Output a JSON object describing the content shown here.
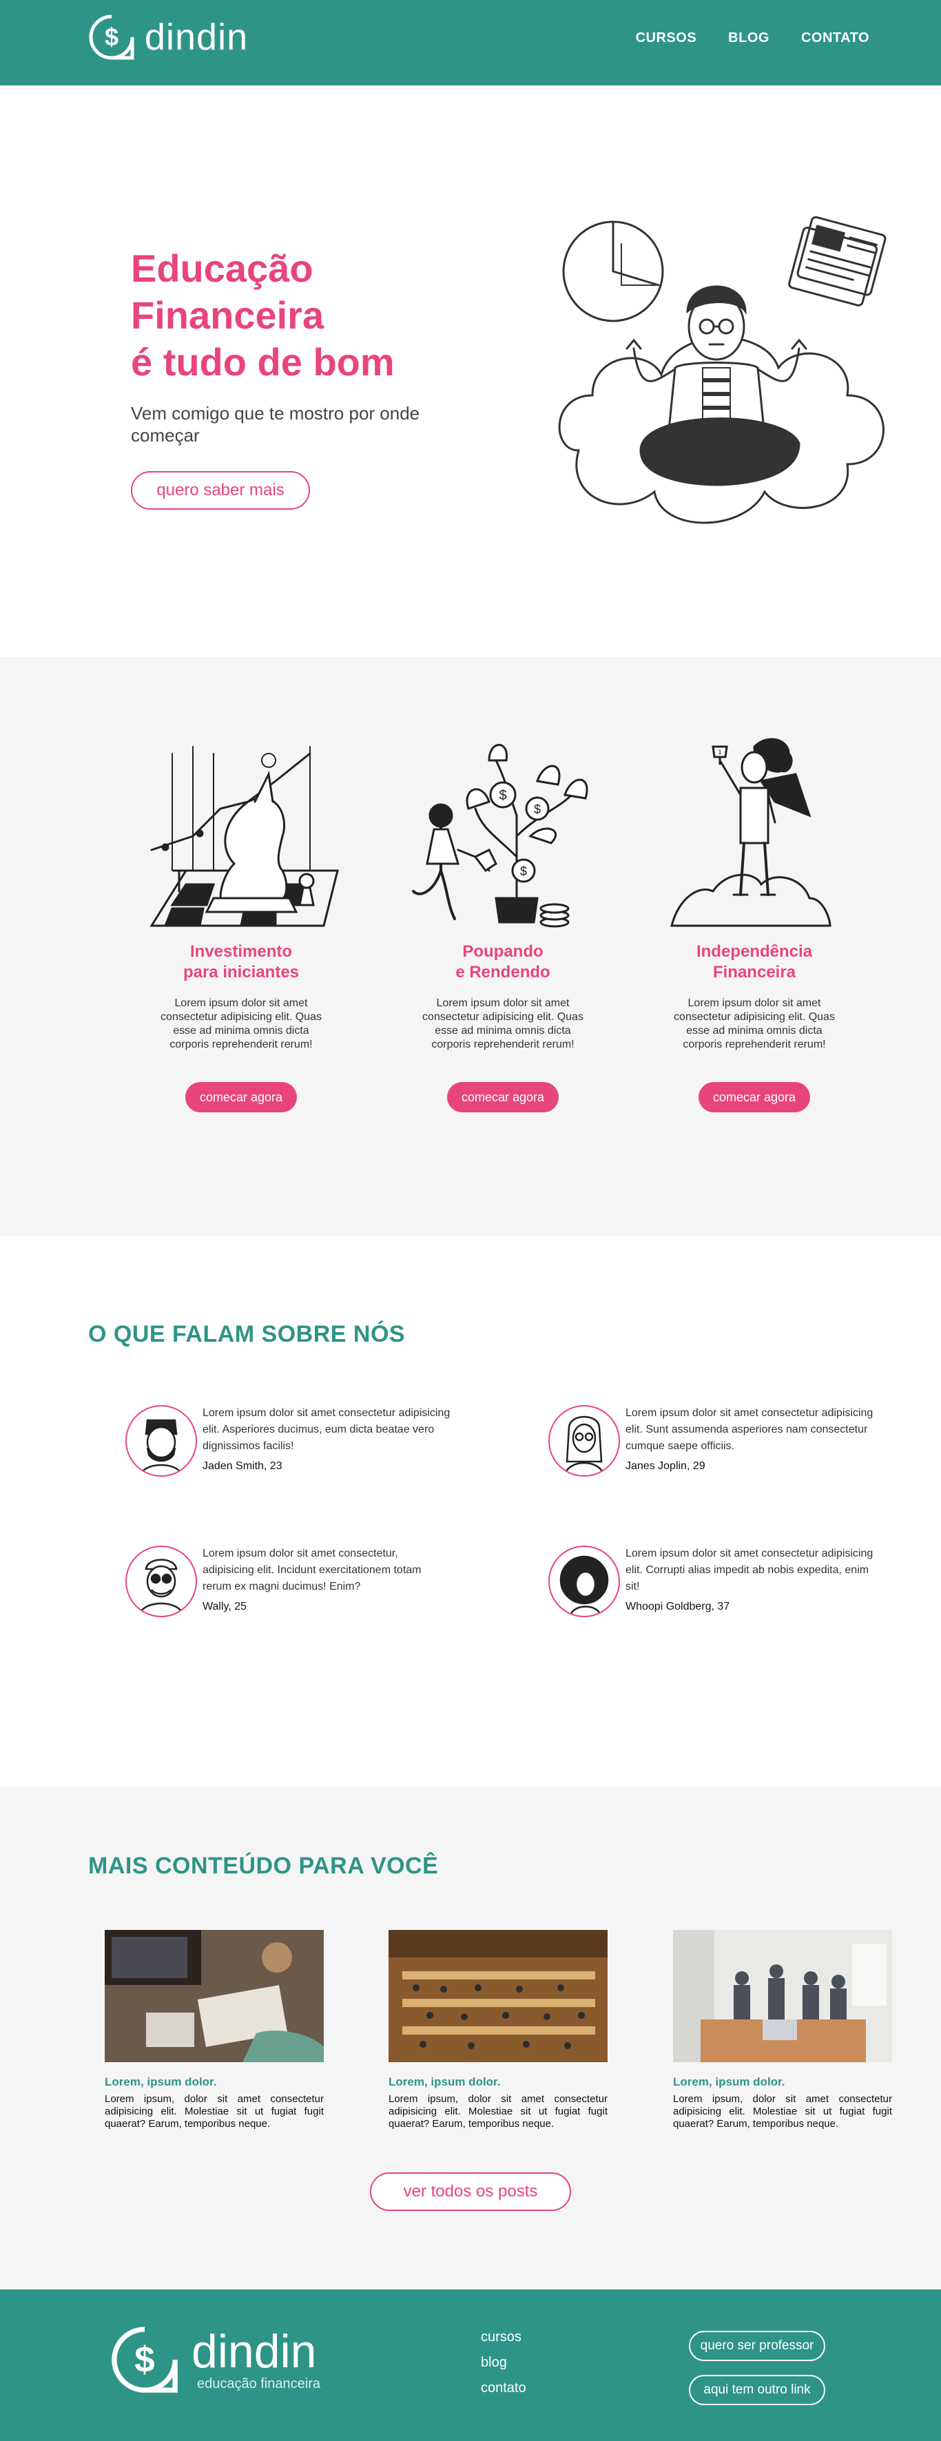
{
  "brand": {
    "name": "dindin",
    "tagline": "educação financeira"
  },
  "nav": {
    "items": [
      "CURSOS",
      "BLOG",
      "CONTATO"
    ]
  },
  "hero": {
    "title_lines": [
      "Educação",
      "Financeira",
      "é tudo de bom"
    ],
    "subtitle": "Vem comigo que te mostro por onde começar",
    "button": "quero saber mais"
  },
  "features": [
    {
      "title_lines": [
        "Investimento",
        "para iniciantes"
      ],
      "text": "Lorem ipsum dolor sit amet consectetur adipisicing elit. Quas esse ad minima omnis dicta corporis reprehenderit rerum!",
      "button": "comecar agora",
      "icon": "chess-unicorn-illustration"
    },
    {
      "title_lines": [
        "Poupando",
        "e Rendendo"
      ],
      "text": "Lorem ipsum dolor sit amet consectetur adipisicing elit. Quas esse ad minima omnis dicta corporis reprehenderit rerum!",
      "button": "comecar agora",
      "icon": "money-tree-illustration"
    },
    {
      "title_lines": [
        "Independência",
        "Financeira"
      ],
      "text": "Lorem ipsum dolor sit amet consectetur adipisicing elit. Quas esse ad minima omnis dicta corporis reprehenderit rerum!",
      "button": "comecar agora",
      "icon": "trophy-hero-illustration"
    }
  ],
  "testimonials": {
    "title": "O QUE FALAM SOBRE NÓS",
    "items": [
      {
        "text": "Lorem ipsum dolor sit amet consectetur adipisicing elit. Asperiores ducimus, eum dicta beatae vero dignissimos facilis!",
        "name": "Jaden Smith, 23"
      },
      {
        "text": "Lorem ipsum dolor sit amet consectetur adipisicing elit. Sunt assumenda asperiores nam consectetur cumque saepe officiis.",
        "name": "Janes Joplin, 29"
      },
      {
        "text": "Lorem ipsum dolor sit amet consectetur, adipisicing elit. Incidunt exercitationem totam rerum ex magni ducimus! Enim?",
        "name": "Wally, 25"
      },
      {
        "text": "Lorem ipsum dolor sit amet consectetur adipisicing elit. Corrupti alias impedit ab nobis expedita, enim sit!",
        "name": "Whoopi Goldberg, 37"
      }
    ]
  },
  "content": {
    "title": "MAIS CONTEÚDO PARA VOCÊ",
    "cards": [
      {
        "title": "Lorem, ipsum dolor.",
        "text": "Lorem ipsum, dolor sit amet consectetur adipisicing elit. Molestiae sit ut fugiat fugit quaerat? Earum, temporibus neque."
      },
      {
        "title": "Lorem, ipsum dolor.",
        "text": "Lorem ipsum, dolor sit amet consectetur adipisicing elit. Molestiae sit ut fugiat fugit quaerat? Earum, temporibus neque."
      },
      {
        "title": "Lorem, ipsum dolor.",
        "text": "Lorem ipsum, dolor sit amet consectetur adipisicing elit. Molestiae sit ut fugiat fugit quaerat? Earum, temporibus neque."
      }
    ],
    "button": "ver todos os posts"
  },
  "footer": {
    "links": [
      "cursos",
      "blog",
      "contato"
    ],
    "buttons": [
      "quero ser professor",
      "aqui tem outro link"
    ]
  },
  "colors": {
    "teal": "#2e9488",
    "pink": "#e8457b",
    "light_bg": "#f5f5f5"
  }
}
